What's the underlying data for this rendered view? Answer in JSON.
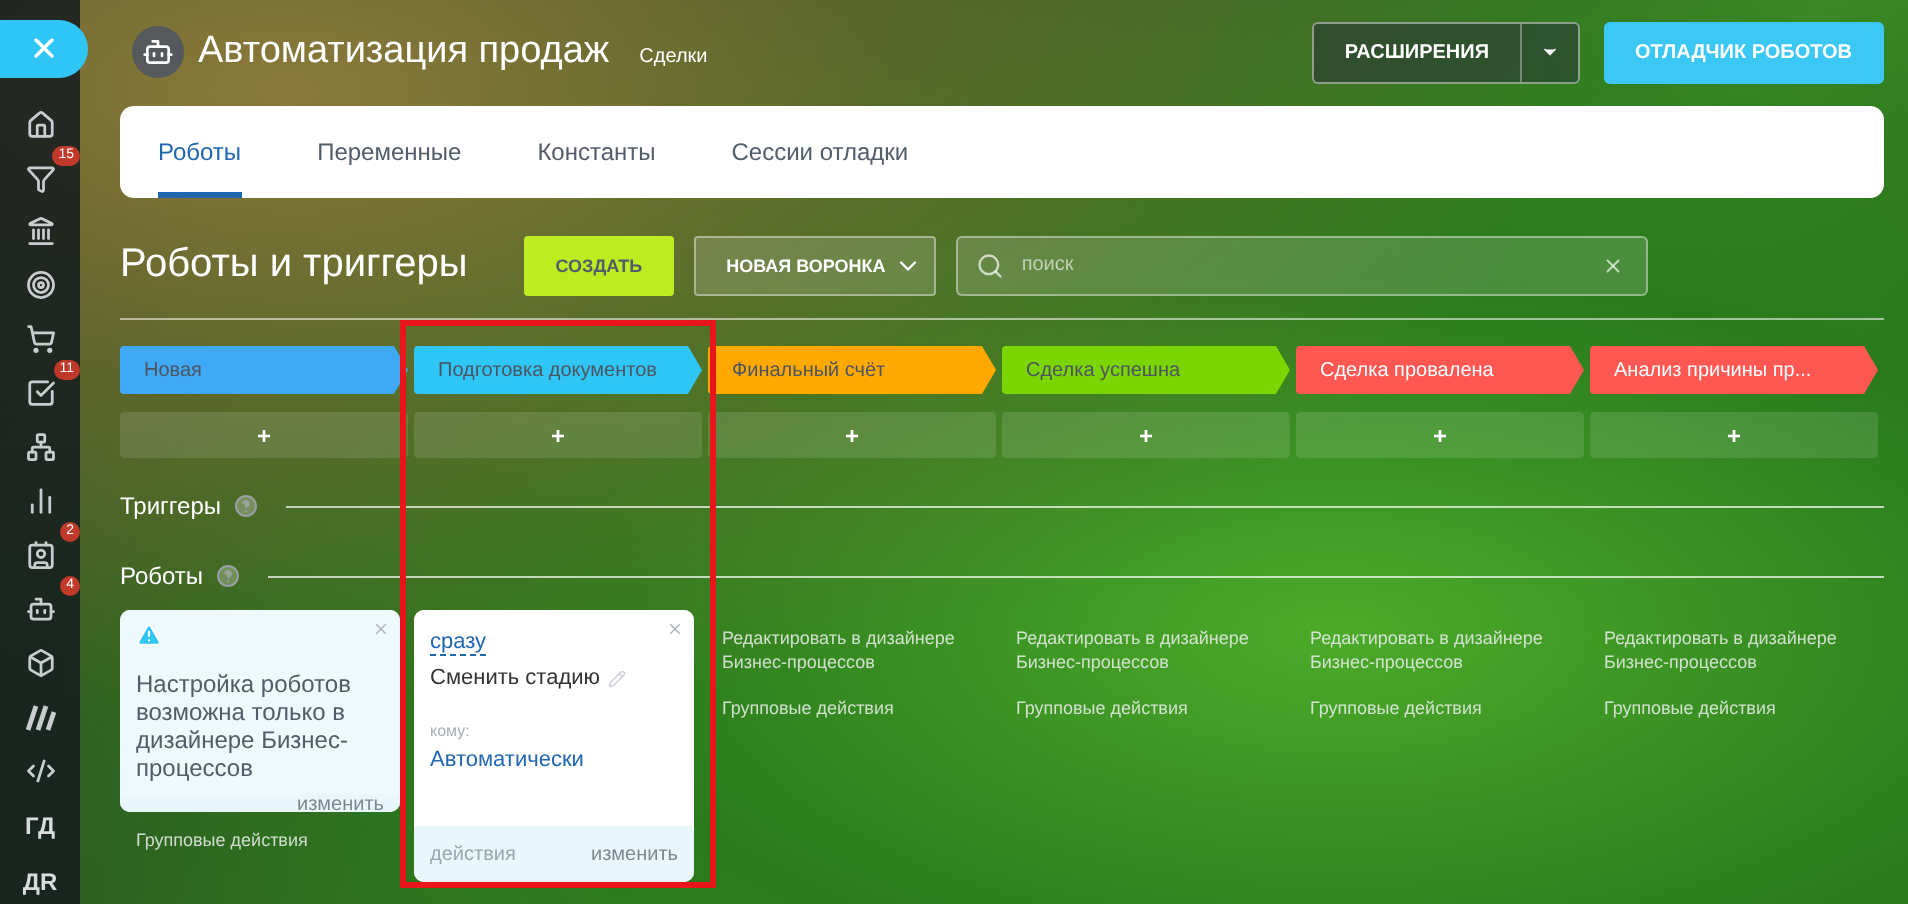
{
  "header": {
    "title": "Автоматизация продаж",
    "subtitle": "Сделки",
    "extensions_button": "РАСШИРЕНИЯ",
    "debugger_button": "ОТЛАДЧИК РОБОТОВ"
  },
  "sidebar": {
    "items": [
      {
        "kind": "close"
      },
      {
        "kind": "icon"
      },
      {
        "kind": "icon",
        "badge": "15"
      },
      {
        "kind": "icon"
      },
      {
        "kind": "icon"
      },
      {
        "kind": "icon"
      },
      {
        "kind": "icon",
        "badge": "11"
      },
      {
        "kind": "icon"
      },
      {
        "kind": "icon"
      },
      {
        "kind": "icon",
        "badge": "2"
      },
      {
        "kind": "icon",
        "badge": "4"
      },
      {
        "kind": "icon"
      },
      {
        "kind": "icon"
      },
      {
        "kind": "icon"
      },
      {
        "kind": "text",
        "label": "ГД"
      },
      {
        "kind": "text",
        "label": "ДR"
      }
    ]
  },
  "tabs": [
    {
      "label": "Роботы",
      "selected": true
    },
    {
      "label": "Переменные",
      "selected": false
    },
    {
      "label": "Константы",
      "selected": false
    },
    {
      "label": "Сессии отладки",
      "selected": false
    }
  ],
  "toolbar": {
    "title": "Роботы и триггеры",
    "create_button": "СОЗДАТЬ",
    "funnel_button": "НОВАЯ ВОРОНКА",
    "search": {
      "placeholder": "поиск"
    }
  },
  "stages": [
    {
      "name": "Новая",
      "color": "#3fa9f5",
      "add_button": "+",
      "highlighted": false
    },
    {
      "name": "Подготовка документов",
      "color": "#2fc6f6",
      "add_button": "+",
      "highlighted": true
    },
    {
      "name": "Финальный счёт",
      "color": "#ffa900",
      "add_button": "+",
      "highlighted": false
    },
    {
      "name": "Сделка успешна",
      "color": "#7bd500",
      "add_button": "+",
      "highlighted": false
    },
    {
      "name": "Сделка провалена",
      "color": "#ff5752",
      "add_button": "+",
      "highlighted": false
    },
    {
      "name": "Анализ причины пр...",
      "color": "#ff5752",
      "add_button": "+",
      "highlighted": false
    }
  ],
  "sections": [
    {
      "title": "Триггеры"
    },
    {
      "title": "Роботы"
    }
  ],
  "robot_columns": [
    {
      "kind": "warning",
      "text": "Настройка роботов возможна только в дизайнере Бизнес-процессов",
      "action": "изменить",
      "group_link": "Групповые действия"
    },
    {
      "kind": "robot",
      "delay": "сразу",
      "name": "Сменить стадию",
      "recipient_label": "кому:",
      "recipient": "Автоматически",
      "actions": "действия",
      "action": "изменить"
    },
    {
      "kind": "links",
      "edit_link": "Редактировать в дизайнере Бизнес-процессов",
      "group_link": "Групповые действия"
    },
    {
      "kind": "links",
      "edit_link": "Редактировать в дизайнере Бизнес-процессов",
      "group_link": "Групповые действия"
    },
    {
      "kind": "links",
      "edit_link": "Редактировать в дизайнере Бизнес-процессов",
      "group_link": "Групповые действия"
    },
    {
      "kind": "links",
      "edit_link": "Редактировать в дизайнере Бизнес-процессов",
      "group_link": "Групповые действия"
    }
  ]
}
